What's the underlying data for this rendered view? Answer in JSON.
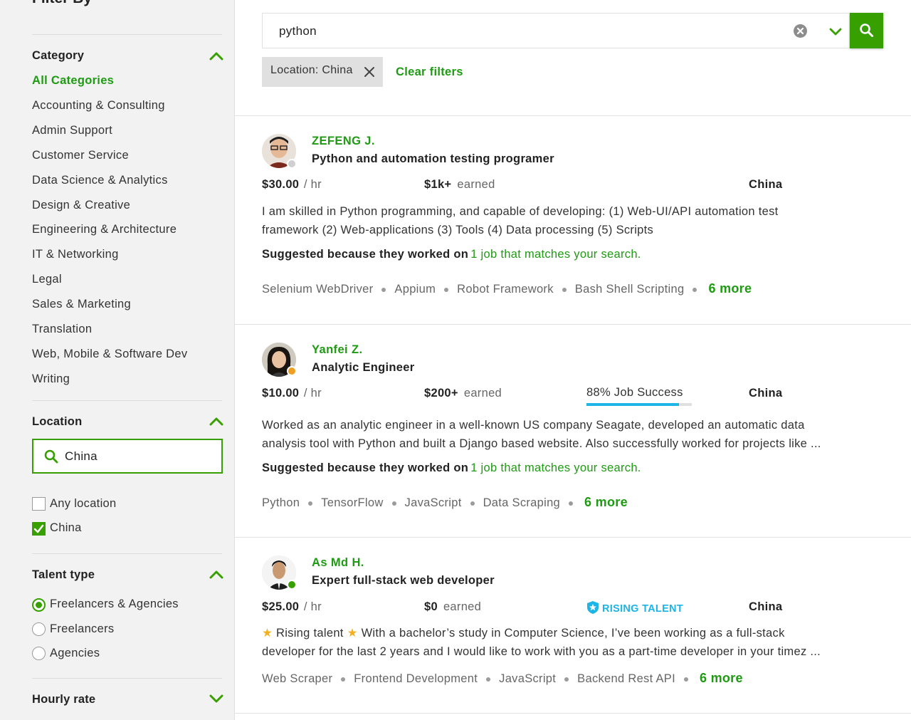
{
  "sidebar": {
    "title": "Filter By",
    "category": {
      "heading": "Category",
      "items": [
        "All Categories",
        "Accounting & Consulting",
        "Admin Support",
        "Customer Service",
        "Data Science & Analytics",
        "Design & Creative",
        "Engineering & Architecture",
        "IT & Networking",
        "Legal",
        "Sales & Marketing",
        "Translation",
        "Web, Mobile & Software Dev",
        "Writing"
      ]
    },
    "location": {
      "heading": "Location",
      "input_value": "China",
      "options": [
        {
          "label": "Any location",
          "checked": false
        },
        {
          "label": "China",
          "checked": true
        }
      ]
    },
    "talent_type": {
      "heading": "Talent type",
      "options": [
        {
          "label": "Freelancers & Agencies",
          "selected": true
        },
        {
          "label": "Freelancers",
          "selected": false
        },
        {
          "label": "Agencies",
          "selected": false
        }
      ]
    },
    "hourly_rate": {
      "heading": "Hourly rate"
    }
  },
  "search": {
    "query": "python",
    "chip": "Location: China",
    "clear_filters": "Clear filters"
  },
  "colors": {
    "accent": "#37a000",
    "link_green": "#1e9b12",
    "rising_blue": "#1db4e6",
    "status_orange": "#f0a020",
    "status_green": "#37a000"
  },
  "results": [
    {
      "name": "ZEFENG J.",
      "title": "Python and automation testing programer",
      "rate": "$30.00",
      "rate_unit": "/ hr",
      "earned_amount": "$1k+",
      "earned_label": "earned",
      "country": "China",
      "status": "offline",
      "desc_line1": "I am skilled in Python programming, and capable of developing: (1) Web-UI/API automation test",
      "desc_line2": "framework (2) Web-applications (3) Tools (4) Data processing (5) Scripts",
      "suggest_prefix": "Suggested because they worked on",
      "suggest_link": "1 job that matches your search.",
      "skills": [
        "Selenium WebDriver",
        "Appium",
        "Robot Framework",
        "Bash Shell Scripting"
      ],
      "more": "6 more"
    },
    {
      "name": "Yanfei Z.",
      "title": "Analytic Engineer",
      "rate": "$10.00",
      "rate_unit": "/ hr",
      "earned_amount": "$200+",
      "earned_label": "earned",
      "job_success": "88% Job Success",
      "job_success_value": 0.88,
      "country": "China",
      "status": "away",
      "desc_line1": "Worked as an analytic engineer in a well-known US company Seagate, developed an automatic data",
      "desc_line2": "analysis tool with Python and built a Django based website. Also successfully worked for projects like ...",
      "suggest_prefix": "Suggested because they worked on",
      "suggest_link": "1 job that matches your search.",
      "skills": [
        "Python",
        "TensorFlow",
        "JavaScript",
        "Data Scraping"
      ],
      "more": "6 more"
    },
    {
      "name": "As Md H.",
      "title": "Expert full-stack web developer",
      "rate": "$25.00",
      "rate_unit": "/ hr",
      "earned_amount": "$0",
      "earned_label": "earned",
      "badge": "RISING TALENT",
      "country": "China",
      "status": "online",
      "desc_line1_a": "Rising talent",
      "desc_line1_b": "With a bachelor’s study in Computer Science, I’ve been working as a full-stack",
      "desc_line2": "developer for the last 2 years and I would like to work with you as a part-time developer in your timez ...",
      "skills": [
        "Web Scraper",
        "Frontend Development",
        "JavaScript",
        "Backend Rest API"
      ],
      "more": "6 more"
    }
  ]
}
